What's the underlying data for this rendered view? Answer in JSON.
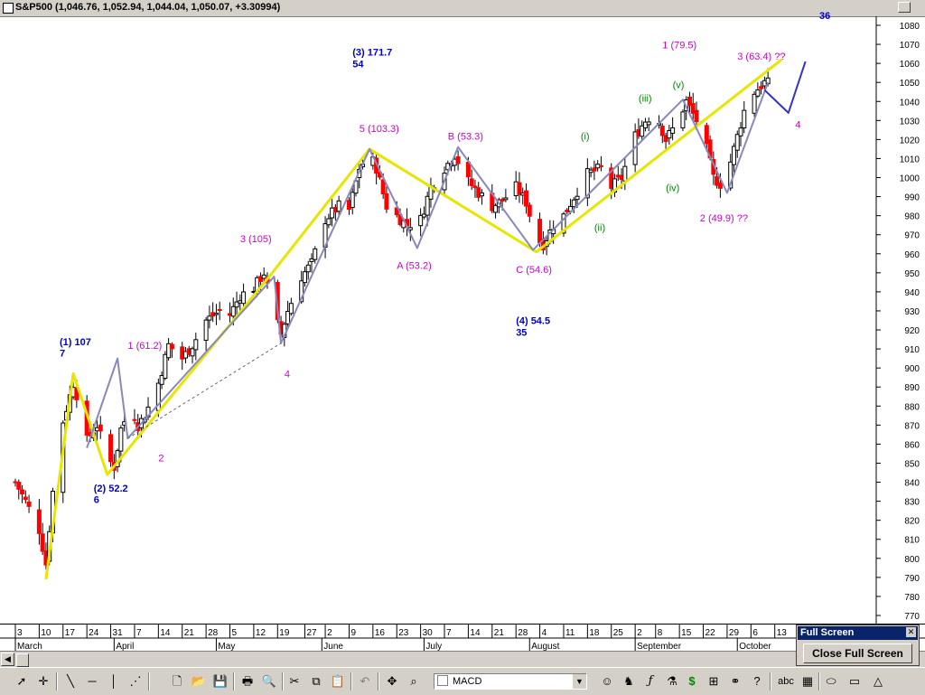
{
  "window": {
    "title": "S&P500 (1,046.76, 1,052.94, 1,044.04, 1,050.07, +3.30994)",
    "corner_value": "36"
  },
  "chart_data": {
    "type": "candlestick",
    "title": "S&P500 (1,046.76, 1,052.94, 1,044.04, 1,050.07, +3.30994)",
    "ylim": [
      770,
      1080
    ],
    "yticks": [
      770,
      780,
      790,
      800,
      810,
      820,
      830,
      840,
      850,
      860,
      870,
      880,
      890,
      900,
      910,
      920,
      930,
      940,
      950,
      960,
      970,
      980,
      990,
      1000,
      1010,
      1020,
      1030,
      1040,
      1050,
      1060,
      1070,
      1080
    ],
    "x_days": [
      {
        "label": "3",
        "day": 0
      },
      {
        "label": "10",
        "day": 7
      },
      {
        "label": "17",
        "day": 14
      },
      {
        "label": "24",
        "day": 21
      },
      {
        "label": "31",
        "day": 28
      },
      {
        "label": "7",
        "day": 35
      },
      {
        "label": "14",
        "day": 42
      },
      {
        "label": "21",
        "day": 49
      },
      {
        "label": "28",
        "day": 56
      },
      {
        "label": "5",
        "day": 63
      },
      {
        "label": "12",
        "day": 70
      },
      {
        "label": "19",
        "day": 77
      },
      {
        "label": "27",
        "day": 85
      },
      {
        "label": "2",
        "day": 91
      },
      {
        "label": "9",
        "day": 98
      },
      {
        "label": "16",
        "day": 105
      },
      {
        "label": "23",
        "day": 112
      },
      {
        "label": "30",
        "day": 119
      },
      {
        "label": "7",
        "day": 126
      },
      {
        "label": "14",
        "day": 133
      },
      {
        "label": "21",
        "day": 140
      },
      {
        "label": "28",
        "day": 147
      },
      {
        "label": "4",
        "day": 154
      },
      {
        "label": "11",
        "day": 161
      },
      {
        "label": "18",
        "day": 168
      },
      {
        "label": "25",
        "day": 175
      },
      {
        "label": "2",
        "day": 182
      },
      {
        "label": "8",
        "day": 188
      },
      {
        "label": "15",
        "day": 195
      },
      {
        "label": "22",
        "day": 202
      },
      {
        "label": "29",
        "day": 209
      },
      {
        "label": "6",
        "day": 216
      },
      {
        "label": "13",
        "day": 223
      }
    ],
    "months": [
      {
        "label": "March",
        "day": 0
      },
      {
        "label": "April",
        "day": 29
      },
      {
        "label": "May",
        "day": 59
      },
      {
        "label": "June",
        "day": 90
      },
      {
        "label": "July",
        "day": 120
      },
      {
        "label": "August",
        "day": 151
      },
      {
        "label": "September",
        "day": 182
      },
      {
        "label": "October",
        "day": 212
      }
    ],
    "close_path": [
      {
        "day": 0,
        "v": 840
      },
      {
        "day": 3,
        "v": 830
      },
      {
        "day": 7,
        "v": 815
      },
      {
        "day": 9,
        "v": 797
      },
      {
        "day": 11,
        "v": 835
      },
      {
        "day": 14,
        "v": 872
      },
      {
        "day": 17,
        "v": 892
      },
      {
        "day": 19,
        "v": 880
      },
      {
        "day": 21,
        "v": 862
      },
      {
        "day": 24,
        "v": 870
      },
      {
        "day": 27,
        "v": 853
      },
      {
        "day": 29,
        "v": 848
      },
      {
        "day": 31,
        "v": 868
      },
      {
        "day": 34,
        "v": 880
      },
      {
        "day": 36,
        "v": 870
      },
      {
        "day": 38,
        "v": 875
      },
      {
        "day": 42,
        "v": 892
      },
      {
        "day": 45,
        "v": 912
      },
      {
        "day": 49,
        "v": 905
      },
      {
        "day": 52,
        "v": 912
      },
      {
        "day": 56,
        "v": 925
      },
      {
        "day": 60,
        "v": 930
      },
      {
        "day": 63,
        "v": 928
      },
      {
        "day": 66,
        "v": 938
      },
      {
        "day": 70,
        "v": 942
      },
      {
        "day": 73,
        "v": 950
      },
      {
        "day": 76,
        "v": 928
      },
      {
        "day": 78,
        "v": 918
      },
      {
        "day": 80,
        "v": 930
      },
      {
        "day": 84,
        "v": 948
      },
      {
        "day": 87,
        "v": 955
      },
      {
        "day": 91,
        "v": 978
      },
      {
        "day": 95,
        "v": 985
      },
      {
        "day": 98,
        "v": 983
      },
      {
        "day": 101,
        "v": 1005
      },
      {
        "day": 104,
        "v": 1012
      },
      {
        "day": 106,
        "v": 1005
      },
      {
        "day": 109,
        "v": 985
      },
      {
        "day": 112,
        "v": 980
      },
      {
        "day": 115,
        "v": 975
      },
      {
        "day": 119,
        "v": 978
      },
      {
        "day": 122,
        "v": 995
      },
      {
        "day": 126,
        "v": 1005
      },
      {
        "day": 129,
        "v": 1012
      },
      {
        "day": 133,
        "v": 998
      },
      {
        "day": 136,
        "v": 992
      },
      {
        "day": 140,
        "v": 985
      },
      {
        "day": 143,
        "v": 988
      },
      {
        "day": 147,
        "v": 995
      },
      {
        "day": 150,
        "v": 987
      },
      {
        "day": 153,
        "v": 968
      },
      {
        "day": 155,
        "v": 965
      },
      {
        "day": 158,
        "v": 975
      },
      {
        "day": 161,
        "v": 980
      },
      {
        "day": 165,
        "v": 993
      },
      {
        "day": 168,
        "v": 1002
      },
      {
        "day": 172,
        "v": 1005
      },
      {
        "day": 175,
        "v": 995
      },
      {
        "day": 178,
        "v": 1000
      },
      {
        "day": 182,
        "v": 1022
      },
      {
        "day": 185,
        "v": 1030
      },
      {
        "day": 188,
        "v": 1034
      },
      {
        "day": 191,
        "v": 1020
      },
      {
        "day": 194,
        "v": 1028
      },
      {
        "day": 197,
        "v": 1040
      },
      {
        "day": 200,
        "v": 1030
      },
      {
        "day": 203,
        "v": 1015
      },
      {
        "day": 205,
        "v": 1000
      },
      {
        "day": 208,
        "v": 995
      },
      {
        "day": 211,
        "v": 1015
      },
      {
        "day": 214,
        "v": 1035
      },
      {
        "day": 217,
        "v": 1045
      },
      {
        "day": 220,
        "v": 1050
      },
      {
        "day": 222,
        "v": 1049
      }
    ],
    "wave_lines": [
      {
        "name": "primary",
        "color": "#e6e600",
        "points": [
          {
            "day": 9,
            "v": 789
          },
          {
            "day": 17,
            "v": 897
          },
          {
            "day": 27,
            "v": 844
          },
          {
            "day": 75,
            "v": 949
          },
          {
            "day": 104,
            "v": 1015
          },
          {
            "day": 153,
            "v": 961
          },
          {
            "day": 225,
            "v": 1062
          }
        ]
      },
      {
        "name": "secondary",
        "color": "#8888bb",
        "points": [
          {
            "day": 21,
            "v": 858
          },
          {
            "day": 30,
            "v": 905
          },
          {
            "day": 33,
            "v": 863
          },
          {
            "day": 76,
            "v": 948
          },
          {
            "day": 78,
            "v": 913
          },
          {
            "day": 104,
            "v": 1015
          },
          {
            "day": 118,
            "v": 963
          },
          {
            "day": 130,
            "v": 1016
          },
          {
            "day": 152,
            "v": 962
          },
          {
            "day": 196,
            "v": 1041
          },
          {
            "day": 209,
            "v": 992
          },
          {
            "day": 221,
            "v": 1050
          }
        ]
      },
      {
        "name": "projection",
        "color": "#3333cc",
        "points": [
          {
            "day": 220,
            "v": 1046
          },
          {
            "day": 227,
            "v": 1034
          },
          {
            "day": 232,
            "v": 1061
          }
        ]
      }
    ],
    "dashed_line": [
      {
        "day": 33,
        "v": 863
      },
      {
        "day": 78,
        "v": 913
      }
    ],
    "annotations": [
      {
        "text": "(1) 107",
        "day": 13,
        "v": 912,
        "color": "#0000cc",
        "bold": true
      },
      {
        "text": "7",
        "day": 13,
        "v": 906,
        "color": "#0000cc",
        "bold": true
      },
      {
        "text": "(2) 52.2",
        "day": 23,
        "v": 835,
        "color": "#0000cc",
        "bold": true
      },
      {
        "text": "6",
        "day": 23,
        "v": 829,
        "color": "#0000cc",
        "bold": true
      },
      {
        "text": "(3) 171.7",
        "day": 99,
        "v": 1064,
        "color": "#0000cc",
        "bold": true
      },
      {
        "text": "54",
        "day": 99,
        "v": 1058,
        "color": "#0000cc",
        "bold": true
      },
      {
        "text": "(4) 54.5",
        "day": 147,
        "v": 923,
        "color": "#0000cc",
        "bold": true
      },
      {
        "text": "35",
        "day": 147,
        "v": 917,
        "color": "#0000cc",
        "bold": true
      },
      {
        "text": "1 (61.2)",
        "day": 33,
        "v": 910,
        "color": "#cc00cc",
        "bold": false
      },
      {
        "text": "2",
        "day": 42,
        "v": 851,
        "color": "#cc00cc",
        "bold": false
      },
      {
        "text": "3 (105)",
        "day": 66,
        "v": 966,
        "color": "#cc00cc",
        "bold": false
      },
      {
        "text": "4",
        "day": 79,
        "v": 895,
        "color": "#cc00cc",
        "bold": false
      },
      {
        "text": "5 (103.3)",
        "day": 101,
        "v": 1024,
        "color": "#cc00cc",
        "bold": false
      },
      {
        "text": "A (53.2)",
        "day": 112,
        "v": 952,
        "color": "#cc00cc",
        "bold": false
      },
      {
        "text": "B (53.3)",
        "day": 127,
        "v": 1020,
        "color": "#cc00cc",
        "bold": false
      },
      {
        "text": "C (54.6)",
        "day": 147,
        "v": 950,
        "color": "#cc00cc",
        "bold": false
      },
      {
        "text": "1 (79.5)",
        "day": 190,
        "v": 1068,
        "color": "#cc00cc",
        "bold": false
      },
      {
        "text": "3 (63.4) ??",
        "day": 212,
        "v": 1062,
        "color": "#cc00cc",
        "bold": false
      },
      {
        "text": "2 (49.9) ??",
        "day": 201,
        "v": 977,
        "color": "#cc00cc",
        "bold": false
      },
      {
        "text": "4",
        "day": 229,
        "v": 1026,
        "color": "#cc00cc",
        "bold": false
      },
      {
        "text": "(i)",
        "day": 166,
        "v": 1020,
        "color": "#008800",
        "bold": false
      },
      {
        "text": "(ii)",
        "day": 170,
        "v": 972,
        "color": "#008800",
        "bold": false
      },
      {
        "text": "(iii)",
        "day": 183,
        "v": 1040,
        "color": "#008800",
        "bold": false
      },
      {
        "text": "(iv)",
        "day": 191,
        "v": 993,
        "color": "#008800",
        "bold": false
      },
      {
        "text": "(v)",
        "day": 193,
        "v": 1047,
        "color": "#008800",
        "bold": false
      }
    ]
  },
  "toolbar": {
    "indicator_selected": "MACD",
    "text_tool_label": "abc"
  },
  "full_screen_panel": {
    "title": "Full Screen",
    "close_glyph": "✕",
    "button_label": "Close Full Screen"
  }
}
